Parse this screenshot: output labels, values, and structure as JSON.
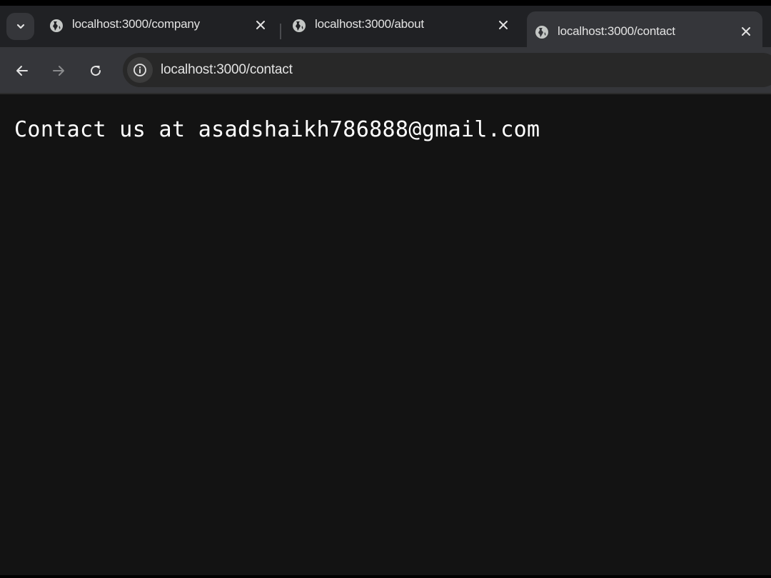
{
  "browser": {
    "tabs": [
      {
        "title": "localhost:3000/company",
        "favicon": "globe-icon",
        "active": false
      },
      {
        "title": "localhost:3000/about",
        "favicon": "globe-icon",
        "active": false
      },
      {
        "title": "localhost:3000/contact",
        "favicon": "globe-icon",
        "active": true
      }
    ],
    "tab_search_icon": "chevron-down-icon",
    "address_bar": {
      "url": "localhost:3000/contact",
      "site_info_icon": "info-icon"
    },
    "nav_icons": [
      "arrow-left-icon",
      "arrow-right-icon",
      "reload-icon"
    ]
  },
  "page": {
    "text": "Contact us at asadshaikh786888@gmail.com"
  },
  "colors": {
    "tabstrip_bg": "#202124",
    "active_tab_bg": "#35363a",
    "toolbar_bg": "#35363a",
    "omnibox_bg": "#282828",
    "page_bg": "#131313",
    "text": "#e3e3e3"
  }
}
